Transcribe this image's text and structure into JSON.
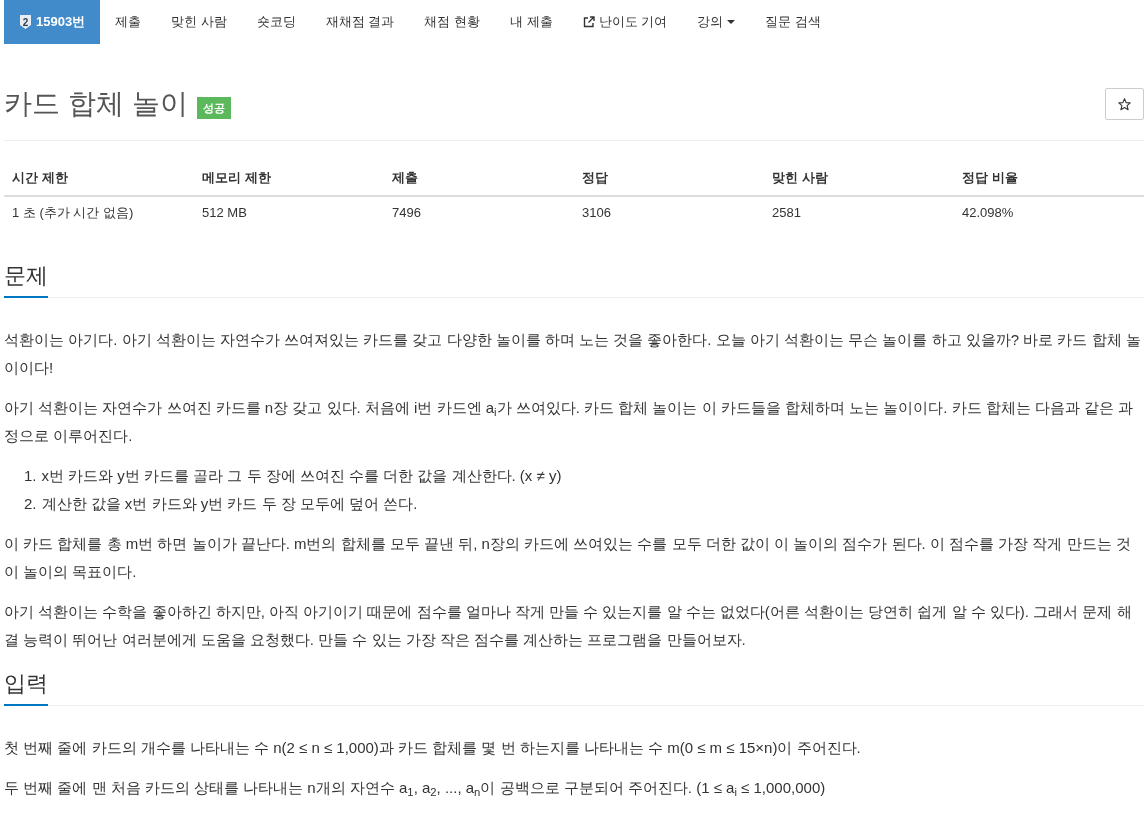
{
  "nav": {
    "items": [
      {
        "label": "15903번",
        "kind": "problem",
        "badge": "2",
        "selected": true
      },
      {
        "label": "제출",
        "kind": "link",
        "selected": false
      },
      {
        "label": "맞힌 사람",
        "kind": "link",
        "selected": false
      },
      {
        "label": "숏코딩",
        "kind": "link",
        "selected": false
      },
      {
        "label": "재채점 결과",
        "kind": "link",
        "selected": false
      },
      {
        "label": "채점 현황",
        "kind": "link",
        "selected": false
      },
      {
        "label": "내 제출",
        "kind": "link",
        "selected": false
      },
      {
        "label": "난이도 기여",
        "kind": "external",
        "selected": false
      },
      {
        "label": "강의",
        "kind": "dropdown",
        "selected": false
      },
      {
        "label": "질문 검색",
        "kind": "link",
        "selected": false
      }
    ]
  },
  "header": {
    "title": "카드 합체 놀이",
    "result": "성공"
  },
  "table": {
    "columns": [
      "시간 제한",
      "메모리 제한",
      "제출",
      "정답",
      "맞힌 사람",
      "정답 비율"
    ],
    "rows": [
      [
        "1 초 (추가 시간 없음)",
        "512 MB",
        "7496",
        "3106",
        "2581",
        "42.098%"
      ]
    ]
  },
  "sections": [
    {
      "heading": "문제",
      "blocks": [
        {
          "kind": "paragraph",
          "text": "석환이는 아기다. 아기 석환이는 자연수가 쓰여져있는 카드를 갖고 다양한 놀이를 하며 노는 것을 좋아한다. 오늘 아기 석환이는 무슨 놀이를 하고 있을까? 바로 카드 합체 놀이이다!"
        },
        {
          "kind": "paragraph",
          "text": "아기 석환이는 자연수가 쓰여진 카드를 n장 갖고 있다. 처음에 i번 카드엔 a$_{i}$가 쓰여있다. 카드 합체 놀이는 이 카드들을 합체하며 노는 놀이이다. 카드 합체는 다음과 같은 과정으로 이루어진다."
        },
        {
          "kind": "ordered_list",
          "items": [
            {
              "marker": "1.",
              "text": "x번 카드와 y번 카드를 골라 그 두 장에 쓰여진 수를 더한 값을 계산한다. (x ≠ y)"
            },
            {
              "marker": "2.",
              "text": "계산한 값을 x번 카드와 y번 카드 두 장 모두에 덮어 쓴다."
            }
          ]
        },
        {
          "kind": "paragraph",
          "text": "이 카드 합체를 총 m번 하면 놀이가 끝난다. m번의 합체를 모두 끝낸 뒤, n장의 카드에 쓰여있는 수를 모두 더한 값이 이 놀이의 점수가 된다. 이 점수를 가장 작게 만드는 것이 놀이의 목표이다."
        },
        {
          "kind": "paragraph",
          "text": "아기 석환이는 수학을 좋아하긴 하지만, 아직 아기이기 때문에 점수를 얼마나 작게 만들 수 있는지를 알 수는 없었다(어른 석환이는 당연히 쉽게 알 수 있다). 그래서 문제 해결 능력이 뛰어난 여러분에게 도움을 요청했다. 만들 수 있는 가장 작은 점수를 계산하는 프로그램을 만들어보자."
        }
      ]
    },
    {
      "heading": "입력",
      "blocks": [
        {
          "kind": "paragraph",
          "text": "첫 번째 줄에 카드의 개수를 나타내는 수 n(2 ≤ n ≤ 1,000)과 카드 합체를 몇 번 하는지를 나타내는 수 m(0 ≤ m ≤ 15×n)이 주어진다."
        },
        {
          "kind": "paragraph",
          "text": "두 번째 줄에 맨 처음 카드의 상태를 나타내는 n개의 자연수 a$_{1}$, a$_{2}$, ..., a$_{n}$이 공백으로 구분되어 주어진다. (1 ≤ a$_{i}$ ≤ 1,000,000)"
        }
      ]
    }
  ]
}
